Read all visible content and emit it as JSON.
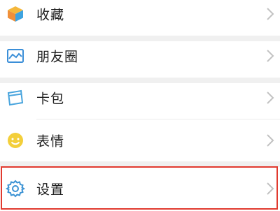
{
  "menu": {
    "items": [
      {
        "label": "收藏",
        "icon": "favorites-cube-icon"
      },
      {
        "label": "朋友圈",
        "icon": "moments-photo-icon"
      },
      {
        "label": "卡包",
        "icon": "card-wallet-icon"
      },
      {
        "label": "表情",
        "icon": "smiley-face-icon"
      },
      {
        "label": "设置",
        "icon": "gear-icon"
      }
    ],
    "selected_index": 4
  },
  "colors": {
    "highlight_border": "#e13a2f",
    "chevron": "#c2c2c2",
    "cube_top": "#f4b73b",
    "cube_left": "#f08f3a",
    "cube_right": "#3da3e0",
    "moments_blue": "#3b8fd8",
    "card_blue": "#48a4dd",
    "smiley_yellow": "#f3cf3b",
    "gear_blue": "#3c93d4"
  }
}
